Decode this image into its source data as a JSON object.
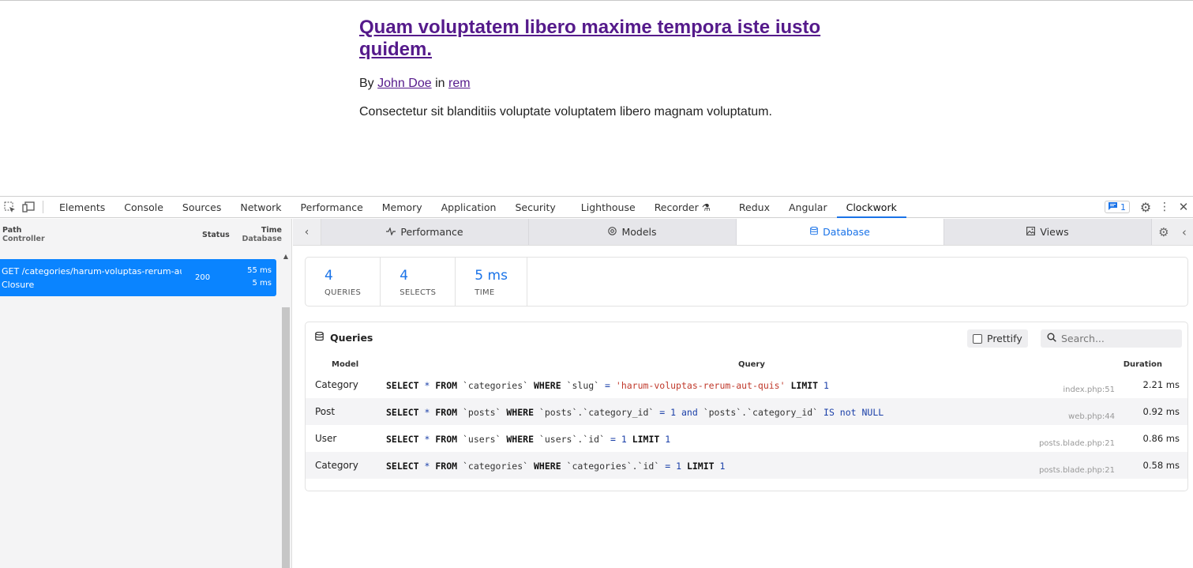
{
  "article": {
    "title": "Quam voluptatem libero maxime tempora iste iusto quidem.",
    "by_label": "By",
    "author": "John Doe",
    "in_label": "in",
    "category": "rem",
    "excerpt": "Consectetur sit blanditiis voluptate voluptatem libero magnam voluptatum."
  },
  "devtools": {
    "tabs": [
      "Elements",
      "Console",
      "Sources",
      "Network",
      "Performance",
      "Memory",
      "Application",
      "Security",
      "Lighthouse",
      "Recorder",
      "Redux",
      "Angular",
      "Clockwork"
    ],
    "active_tab": "Clockwork",
    "issues_count": "1"
  },
  "clockwork": {
    "left_header": {
      "path": "Path",
      "controller": "Controller",
      "status": "Status",
      "time": "Time",
      "database": "Database"
    },
    "request": {
      "path": "GET /categories/harum-voluptas-rerum-aut-quis",
      "controller": "Closure",
      "status": "200",
      "time": "55 ms",
      "db_time": "5 ms"
    },
    "tabs": [
      {
        "label": "Performance",
        "icon": "activity-icon"
      },
      {
        "label": "Models",
        "icon": "target-icon"
      },
      {
        "label": "Database",
        "icon": "database-icon"
      },
      {
        "label": "Views",
        "icon": "image-icon"
      }
    ],
    "active_tab": "Database",
    "stats": [
      {
        "value": "4",
        "label": "QUERIES"
      },
      {
        "value": "4",
        "label": "SELECTS"
      },
      {
        "value": "5 ms",
        "label": "TIME"
      }
    ],
    "queries_panel": {
      "title": "Queries",
      "prettify_label": "Prettify",
      "prettify_checked": false,
      "search_placeholder": "Search...",
      "columns": {
        "model": "Model",
        "query": "Query",
        "duration": "Duration"
      },
      "rows": [
        {
          "model": "Category",
          "source": "index.php:51",
          "duration": "2.21 ms"
        },
        {
          "model": "Post",
          "source": "web.php:44",
          "duration": "0.92 ms"
        },
        {
          "model": "User",
          "source": "posts.blade.php:21",
          "duration": "0.86 ms"
        },
        {
          "model": "Category",
          "source": "posts.blade.php:21",
          "duration": "0.58 ms"
        }
      ]
    }
  }
}
